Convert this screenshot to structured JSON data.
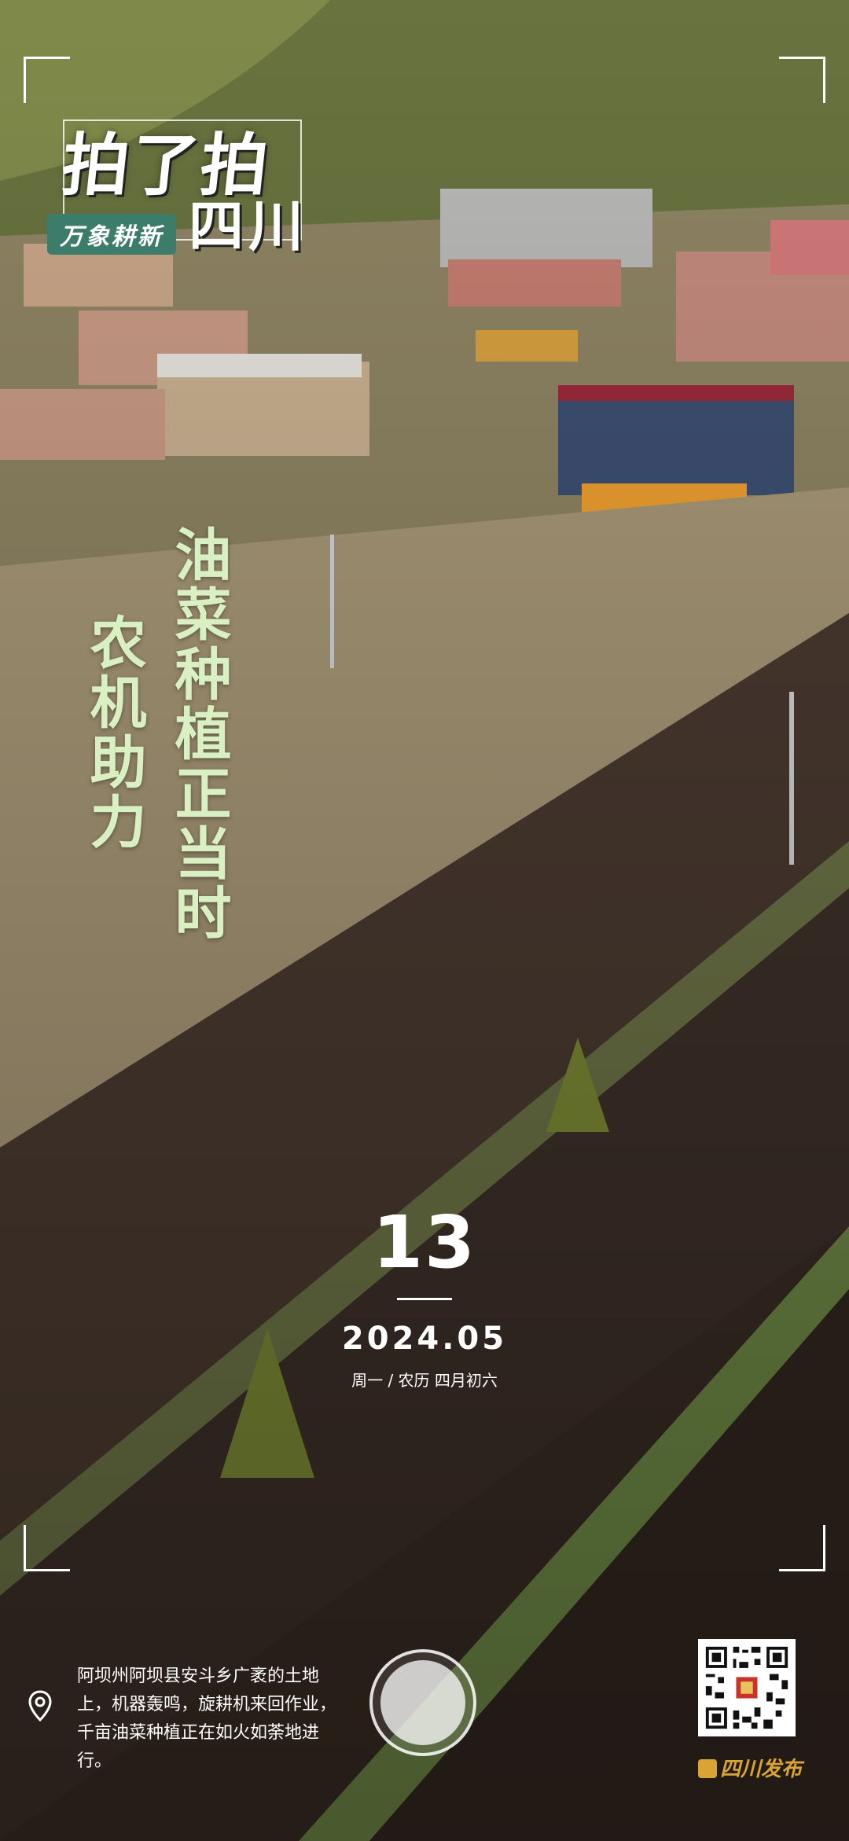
{
  "logo": {
    "line1": "拍了拍",
    "line2": "四川",
    "badge": "万象耕新"
  },
  "headline": {
    "column_right": "油菜种植正当时",
    "column_left": "农机助力"
  },
  "date": {
    "day": "13",
    "year_month": "2024.05",
    "weekday": "周一",
    "separator": "/",
    "lunar": "农历 四月初六"
  },
  "caption": {
    "text": "阿坝州阿坝县安斗乡广袤的土地上，机器轰鸣，旋耕机来回作业，千亩油菜种植正在如火如荼地进行。"
  },
  "footer": {
    "brand": "四川发布"
  },
  "icons": {
    "location": "location-pin-icon",
    "qr": "qr-code",
    "capture": "capture-button"
  },
  "colors": {
    "title_green": "#d8f0c2",
    "badge_green": "#3b7d6a",
    "brand_gold": "#d9a336"
  }
}
